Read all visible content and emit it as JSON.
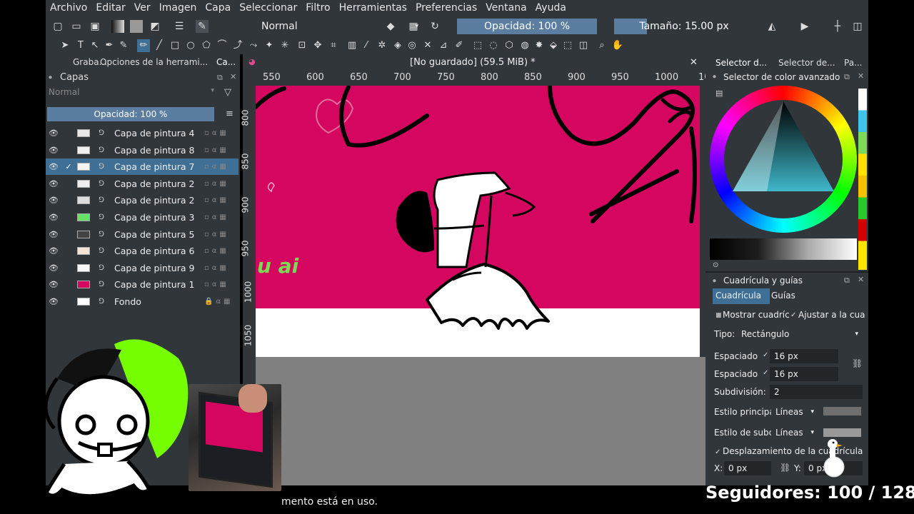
{
  "menu": [
    "Archivo",
    "Editar",
    "Ver",
    "Imagen",
    "Capa",
    "Seleccionar",
    "Filtro",
    "Herramientas",
    "Preferencias",
    "Ventana",
    "Ayuda"
  ],
  "toolbar": {
    "blend_mode": "Normal",
    "opacity_label": "Opacidad: 100 %",
    "size_label": "Tamaño: 15.00 px"
  },
  "left_dock": {
    "tabs": [
      "Graba...",
      "Opciones de la herrami...",
      "Ca..."
    ],
    "layers_title": "Capas",
    "blend_mode": "Normal",
    "opacity_label": "Opacidad: 100 %",
    "layers": [
      {
        "name": "Capa de pintura 4",
        "thumb": "#e8e8e8",
        "selected": false,
        "checked": false,
        "locked": false
      },
      {
        "name": "Capa de pintura 8",
        "thumb": "#f0f0f0",
        "selected": false,
        "checked": false,
        "locked": false
      },
      {
        "name": "Capa de pintura 7",
        "thumb": "#f4f4f4",
        "selected": true,
        "checked": true,
        "locked": false
      },
      {
        "name": "Capa de pintura 2",
        "thumb": "#eeeeee",
        "selected": false,
        "checked": false,
        "locked": false
      },
      {
        "name": "Capa de pintura 2",
        "thumb": "#dddddd",
        "selected": false,
        "checked": false,
        "locked": false
      },
      {
        "name": "Capa de pintura 3",
        "thumb": "#66e066",
        "selected": false,
        "checked": false,
        "locked": false
      },
      {
        "name": "Capa de pintura 5",
        "thumb": "#444444",
        "selected": false,
        "checked": false,
        "locked": false
      },
      {
        "name": "Capa de pintura 6",
        "thumb": "#f3e4d8",
        "selected": false,
        "checked": false,
        "locked": false
      },
      {
        "name": "Capa de pintura 9",
        "thumb": "#f8f8f8",
        "selected": false,
        "checked": false,
        "locked": false
      },
      {
        "name": "Capa de pintura 1",
        "thumb": "#d4065f",
        "selected": false,
        "checked": false,
        "locked": false
      },
      {
        "name": "Fondo",
        "thumb": "#ffffff",
        "selected": false,
        "checked": false,
        "locked": true
      }
    ]
  },
  "canvas": {
    "doc_title": "[No guardado]  (59.5 MiB) *",
    "ruler_top": [
      "550",
      "600",
      "650",
      "700",
      "750",
      "800",
      "850",
      "900",
      "950",
      "1000",
      "10"
    ],
    "ruler_left": [
      "800",
      "850",
      "900",
      "950",
      "1000",
      "1050"
    ],
    "canvas_color": "#d4065f",
    "floor_color": "#ffffff",
    "art_text": "u ai",
    "status_text": "mento está en uso."
  },
  "right_dock": {
    "tabs": [
      "Selector d...",
      "Selector de...",
      "Pa..."
    ],
    "color_panel_title": "Selector de color avanzado",
    "grid_panel_title": "Cuadrícula y guías",
    "grid_tabs": [
      "Cuadrícula",
      "Guías"
    ],
    "show_grid_label": "Mostrar cuadríc",
    "snap_label": "Ajustar a la cua",
    "type_label": "Tipo:",
    "type_value": "Rectángulo",
    "spacing_label": "Espaciado",
    "spacing_x": "16 px",
    "spacing_y": "16 px",
    "subdivision_label": "Subdivisión:",
    "subdivision_value": "2",
    "main_style_label": "Estilo principa",
    "main_style_value": "Líneas",
    "sub_style_label": "Estilo de subc",
    "sub_style_value": "Líneas",
    "offset_label": "Desplazamiento de la cuadrícula",
    "x_label": "X:",
    "x_value": "0 px",
    "y_label": "Y:",
    "y_value": "0 px"
  },
  "overlay": {
    "followers": "Seguidores: 100 / 128"
  }
}
